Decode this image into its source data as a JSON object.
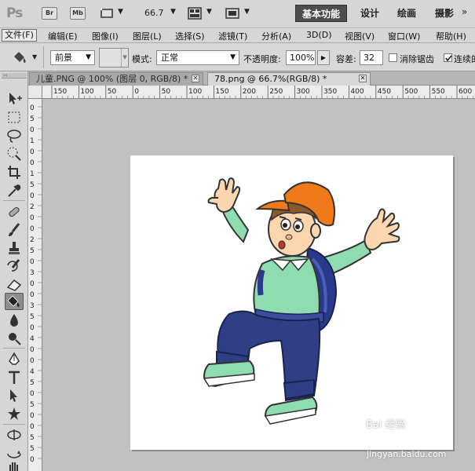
{
  "appbar": {
    "logo": "Ps",
    "bridge_label": "Br",
    "minibridge_label": "Mb",
    "zoom_value": "66.7",
    "workspaces": [
      "基本功能",
      "设计",
      "绘画",
      "摄影"
    ],
    "more": "»"
  },
  "menubar": {
    "items": [
      "文件(F)",
      "编辑(E)",
      "图像(I)",
      "图层(L)",
      "选择(S)",
      "滤镜(T)",
      "分析(A)",
      "3D(D)",
      "视图(V)",
      "窗口(W)",
      "帮助(H)"
    ]
  },
  "options": {
    "fill_source": "前景",
    "mode_label": "模式:",
    "mode_value": "正常",
    "opacity_label": "不透明度:",
    "opacity_value": "100%",
    "tolerance_label": "容差:",
    "tolerance_value": "32",
    "antialias_label": "消除锯齿",
    "antialias_checked": false,
    "contiguous_label": "连续的",
    "contiguous_checked": true
  },
  "tabs": [
    {
      "label": "儿童.PNG @ 100% (图层 0, RGB/8) *",
      "active": false
    },
    {
      "label": "78.png @ 66.7%(RGB/8) *",
      "active": true
    }
  ],
  "ruler_h_labels": [
    "150",
    "100",
    "50",
    "0",
    "50",
    "100",
    "150",
    "200",
    "250",
    "300",
    "350",
    "400",
    "450",
    "500",
    "550",
    "600"
  ],
  "ruler_v_labels": [
    "0",
    "5",
    "0",
    "1",
    "0",
    "0",
    "1",
    "5",
    "0",
    "2",
    "0",
    "0",
    "2",
    "5",
    "0",
    "3",
    "0",
    "0",
    "3",
    "5",
    "0",
    "4",
    "0",
    "0",
    "4",
    "5",
    "0",
    "5",
    "0",
    "0",
    "5",
    "5",
    "0"
  ],
  "watermark": {
    "brand": "Bai 经验",
    "url": "jingyan.baidu.com"
  },
  "colors": {
    "workspace_active_bg": "#4d4d4d",
    "hat": "#f07a1a",
    "shirt": "#8fdcb0",
    "pants": "#2e3f85",
    "backpack": "#2a3a8a",
    "skin": "#fcd6ae"
  },
  "tools": [
    "move-icon",
    "marquee-icon",
    "lasso-icon",
    "quick-select-icon",
    "crop-icon",
    "eyedropper-icon",
    "healing-brush-icon",
    "brush-icon",
    "clone-stamp-icon",
    "history-brush-icon",
    "eraser-icon",
    "paint-bucket-icon",
    "blur-icon",
    "dodge-icon",
    "pen-icon",
    "type-icon",
    "path-select-icon",
    "shape-icon",
    "3d-rotate-icon",
    "3d-orbit-icon",
    "hand-icon"
  ]
}
